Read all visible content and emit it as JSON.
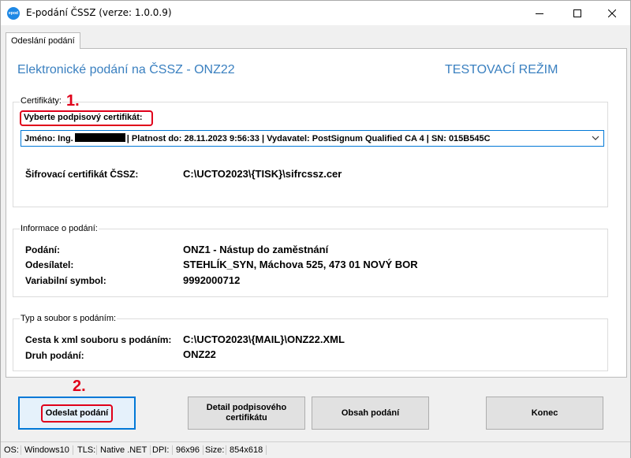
{
  "window": {
    "title": "E-podání ČSSZ (verze: 1.0.0.9)",
    "icon_label": "epod"
  },
  "tab": {
    "label": "Odeslání podání"
  },
  "header": {
    "title": "Elektronické podání na ČSSZ - ONZ22",
    "mode": "TESTOVACÍ REŽIM"
  },
  "certificates": {
    "legend": "Certifikáty:",
    "select_label": "Vyberte podpisový certifikát:",
    "selected_prefix": "Jméno: Ing.",
    "selected_suffix": "| Platnost do: 28.11.2023 9:56:33 | Vydavatel: PostSignum Qualified CA 4 | SN: 015B545C",
    "encryption_label": "Šifrovací certifikát ČSSZ:",
    "encryption_value": "C:\\UCTO2023\\{TISK}\\sifrcssz.cer"
  },
  "info": {
    "legend": "Informace o podání:",
    "rows": [
      {
        "label": "Podání:",
        "value": "ONZ1 - Nástup do zaměstnání"
      },
      {
        "label": "Odesílatel:",
        "value": "STEHLÍK_SYN, Máchova 525, 473 01 NOVÝ BOR"
      },
      {
        "label": "Variabilní symbol:",
        "value": "9992000712"
      }
    ]
  },
  "file": {
    "legend": "Typ a soubor s podáním:",
    "rows": [
      {
        "label": "Cesta k xml souboru s podáním:",
        "value": "C:\\UCTO2023\\{MAIL}\\ONZ22.XML"
      },
      {
        "label": "Druh podání:",
        "value": "ONZ22"
      }
    ]
  },
  "annotations": {
    "step1": "1.",
    "step2": "2."
  },
  "buttons": {
    "send": "Odeslat podání",
    "detail_line1": "Detail podpisového",
    "detail_line2": "certifikátu",
    "content": "Obsah podání",
    "end": "Konec"
  },
  "statusbar": {
    "os_label": "OS:",
    "os_value": "Windows10",
    "tls_label": "TLS:",
    "tls_value": "Native .NET",
    "dpi_label": "DPI:",
    "dpi_value": "96x96",
    "size_label": "Size:",
    "size_value": "854x618"
  },
  "colors": {
    "accent": "#0078d7",
    "title_blue": "#3a80c0",
    "annotation_red": "#e0001a"
  }
}
